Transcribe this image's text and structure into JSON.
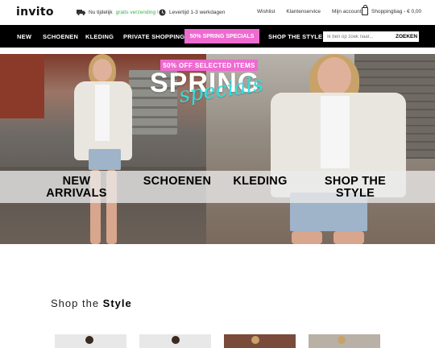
{
  "header": {
    "logo": "invito",
    "usp1_prefix": "Nu tijdelijk",
    "usp1_highlight": "gratis verzending !",
    "usp2": "Levertijd 1-3 werkdagen",
    "links": [
      "Wishlist",
      "Klantenservice",
      "Mijn account"
    ],
    "cart": "Shoppingbag - € 0,00"
  },
  "nav": {
    "items": [
      "NEW",
      "SCHOENEN",
      "KLEDING",
      "PRIVATE SHOPPING",
      "50% SPRING SPECIALS",
      "SHOP THE STYLE"
    ],
    "search_placeholder": "Ik ben op zoek naar...",
    "search_button": "ZOEKEN"
  },
  "hero": {
    "badge": "50% OFF SELECTED ITEMS",
    "title": "SPRING",
    "title_script": "specials",
    "categories": [
      {
        "line1": "NEW",
        "line2": "ARRIVALS"
      },
      {
        "line1": "SCHOENEN",
        "line2": ""
      },
      {
        "line1": "KLEDING",
        "line2": ""
      },
      {
        "line1": "SHOP THE",
        "line2": "STYLE"
      }
    ]
  },
  "section": {
    "title_light": "Shop the ",
    "title_bold": "Style"
  },
  "colors": {
    "accent_pink": "#ee6bd0",
    "script_cyan": "#2ee0e0",
    "nav_bg": "#000000",
    "usp_green": "#39b54a"
  }
}
